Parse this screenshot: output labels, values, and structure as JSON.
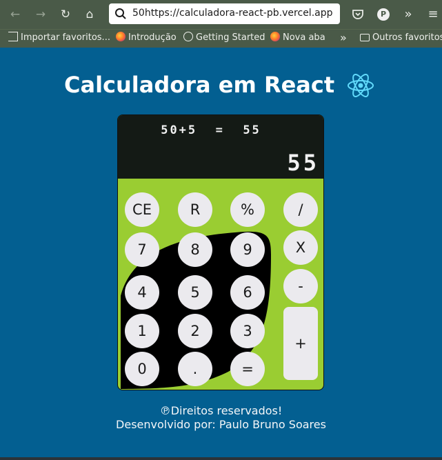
{
  "browser": {
    "url": "50https://calculadora-react-pb.vercel.app",
    "profile_initial": "P",
    "icons": {
      "back": "arrow-left-icon",
      "forward": "arrow-right-icon",
      "reload": "reload-icon",
      "home": "home-icon",
      "pocket": "pocket-icon",
      "overflow": "chevron-double-right-icon",
      "menu": "hamburger-icon"
    },
    "bookmarks": [
      {
        "label": "Importar favoritos...",
        "icon": "import-icon"
      },
      {
        "label": "Introdução",
        "icon": "firefox-icon"
      },
      {
        "label": "Getting Started",
        "icon": "globe-icon"
      },
      {
        "label": "Nova aba",
        "icon": "firefox-icon"
      }
    ],
    "other_bookmarks": "Outros favoritos"
  },
  "page": {
    "title": "Calculadora em React",
    "react_logo": "react-logo-icon"
  },
  "calculator": {
    "expression": "50+5  =  55",
    "result": "55",
    "keys": {
      "ce": "CE",
      "r": "R",
      "percent": "%",
      "divide": "/",
      "multiply": "X",
      "minus": "-",
      "plus": "+",
      "seven": "7",
      "eight": "8",
      "nine": "9",
      "four": "4",
      "five": "5",
      "six": "6",
      "one": "1",
      "two": "2",
      "three": "3",
      "zero": "0",
      "dot": ".",
      "equals": "="
    },
    "colors": {
      "display_bg": "#141a15",
      "keypad_bg": "#9acd32",
      "key_bg": "#ebeaee",
      "page_bg": "#035f91"
    }
  },
  "footer": {
    "rights": "℗Direitos reservados!",
    "author": "Desenvolvido por: Paulo Bruno Soares"
  }
}
